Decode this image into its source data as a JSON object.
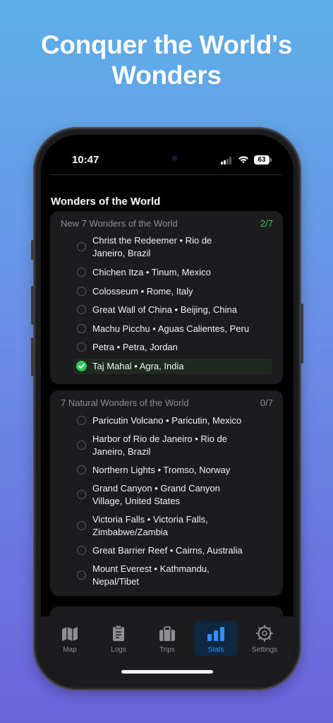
{
  "headline": {
    "line1": "Conquer the World's",
    "line2": "Wonders"
  },
  "status_bar": {
    "time": "10:47",
    "battery": "63"
  },
  "page_title": "Wonders of the World",
  "sections": [
    {
      "title": "New 7 Wonders of the World",
      "count": "2/7",
      "count_color": "#34c759",
      "items": [
        {
          "line1": "Christ the Redeemer • Rio de",
          "line2": "Janeiro, Brazil",
          "checked": false
        },
        {
          "line1": "Chichen Itza • Tinum, Mexico",
          "line2": "",
          "checked": false
        },
        {
          "line1": "Colosseum • Rome, Italy",
          "line2": "",
          "checked": false
        },
        {
          "line1": "Great Wall of China • Beijing, China",
          "line2": "",
          "checked": false
        },
        {
          "line1": "Machu Picchu • Aguas Calientes, Peru",
          "line2": "",
          "checked": false
        },
        {
          "line1": "Petra • Petra, Jordan",
          "line2": "",
          "checked": false
        },
        {
          "line1": "Taj Mahal • Agra, India",
          "line2": "",
          "checked": true
        }
      ]
    },
    {
      "title": "7 Natural Wonders of the World",
      "count": "0/7",
      "count_color": "#8e8e93",
      "items": [
        {
          "line1": "Paricutin Volcano • Paricutin, Mexico",
          "line2": "",
          "checked": false
        },
        {
          "line1": "Harbor of Rio de Janeiro • Rio de",
          "line2": "Janeiro, Brazil",
          "checked": false
        },
        {
          "line1": "Northern Lights • Tromso, Norway",
          "line2": "",
          "checked": false
        },
        {
          "line1": "Grand Canyon • Grand Canyon",
          "line2": "Village, United States",
          "checked": false
        },
        {
          "line1": "Victoria Falls • Victoria Falls,",
          "line2": "Zimbabwe/Zambia",
          "checked": false
        },
        {
          "line1": "Great Barrier Reef • Cairns, Australia",
          "line2": "",
          "checked": false
        },
        {
          "line1": "Mount Everest • Kathmandu,",
          "line2": "Nepal/Tibet",
          "checked": false
        }
      ]
    }
  ],
  "tabs": [
    {
      "label": "Map",
      "icon": "map-icon",
      "active": false
    },
    {
      "label": "Logs",
      "icon": "clipboard-icon",
      "active": false
    },
    {
      "label": "Trips",
      "icon": "suitcase-icon",
      "active": false
    },
    {
      "label": "Stats",
      "icon": "bar-chart-icon",
      "active": true
    },
    {
      "label": "Settings",
      "icon": "gear-icon",
      "active": false
    }
  ],
  "colors": {
    "accent": "#2f93ff",
    "success": "#34c759"
  }
}
